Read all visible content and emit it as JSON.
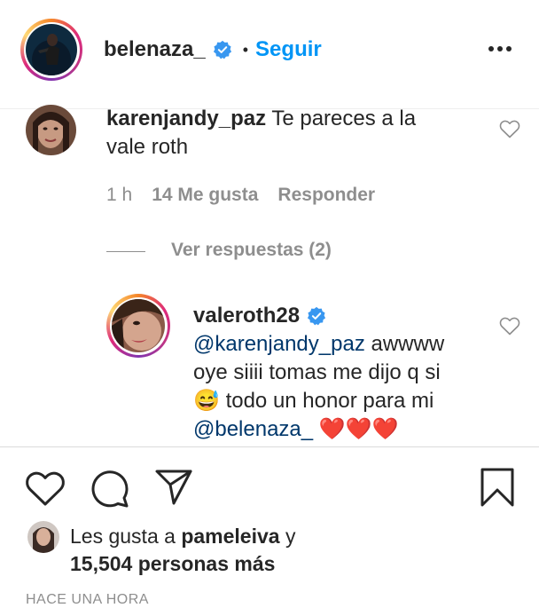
{
  "post": {
    "username": "belenaza_",
    "separator": "•",
    "follow_label": "Seguir",
    "more_icon": "more-options-icon"
  },
  "comment": {
    "username": "karenjandy_paz",
    "text_line1": "Te pareces a la",
    "text_line2": "vale roth",
    "time": "1 h",
    "likes": "14 Me gusta",
    "reply_label": "Responder",
    "view_replies": "Ver respuestas (2)"
  },
  "reply": {
    "username": "valeroth28",
    "mention1": "@karenjandy_paz",
    "text_line1_rest": "awwww",
    "text_line2": "oye siiii tomas me dijo q si",
    "emoji": "😅",
    "text_line3_rest": "todo un honor para mi",
    "mention2": "@belenaza_",
    "hearts": "❤️❤️❤️"
  },
  "likes": {
    "prefix": "Les gusta a ",
    "user": "pameleiva",
    "mid": " y",
    "count_line": "15,504 personas más"
  },
  "timestamp": "HACE UNA HORA",
  "colors": {
    "link": "#0095f6",
    "mention": "#00376b",
    "secondary": "#8e8e8e",
    "verified": "#3897f0"
  }
}
